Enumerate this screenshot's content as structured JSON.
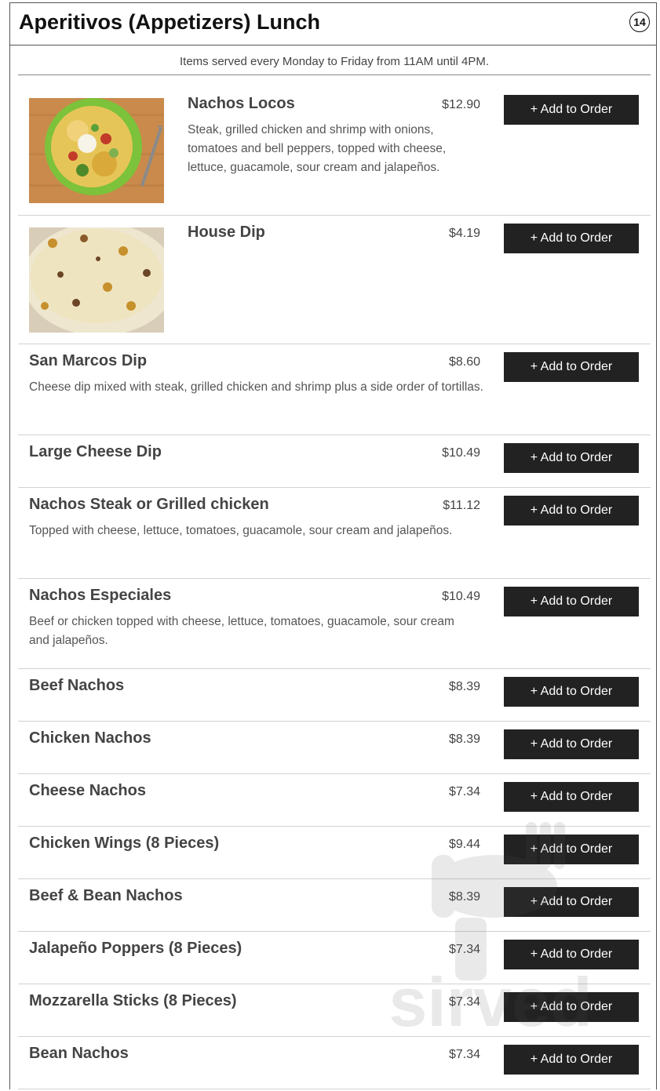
{
  "header": {
    "title": "Aperitivos (Appetizers) Lunch",
    "count": "14"
  },
  "subtitle": "Items served every Monday to Friday from 11AM until 4PM.",
  "watermark": "sirved",
  "items": [
    {
      "name": "Nachos Locos",
      "price": "$12.90",
      "desc": "Steak, grilled chicken and shrimp with onions, tomatoes and bell peppers, topped with cheese, lettuce, guacamole, sour cream and jalapeños.",
      "button": "+ Add to Order"
    },
    {
      "name": "House Dip",
      "price": "$4.19",
      "desc": "",
      "button": "+ Add to Order"
    },
    {
      "name": "San Marcos Dip",
      "price": "$8.60",
      "desc": "Cheese dip mixed with steak, grilled chicken and shrimp plus a side order of tortillas.",
      "button": "+ Add to Order"
    },
    {
      "name": "Large Cheese Dip",
      "price": "$10.49",
      "desc": "",
      "button": "+ Add to Order"
    },
    {
      "name": "Nachos Steak or Grilled chicken",
      "price": "$11.12",
      "desc": "Topped with cheese, lettuce, tomatoes, guacamole, sour cream and jalapeños.",
      "button": "+ Add to Order"
    },
    {
      "name": "Nachos Especiales",
      "price": "$10.49",
      "desc": "Beef or chicken topped with cheese, lettuce, tomatoes, guacamole, sour cream and jalapeños.",
      "button": "+ Add to Order"
    },
    {
      "name": "Beef Nachos",
      "price": "$8.39",
      "desc": "",
      "button": "+ Add to Order"
    },
    {
      "name": "Chicken Nachos",
      "price": "$8.39",
      "desc": "",
      "button": "+ Add to Order"
    },
    {
      "name": "Cheese Nachos",
      "price": "$7.34",
      "desc": "",
      "button": "+ Add to Order"
    },
    {
      "name": "Chicken Wings (8 Pieces)",
      "price": "$9.44",
      "desc": "",
      "button": "+ Add to Order"
    },
    {
      "name": "Beef & Bean Nachos",
      "price": "$8.39",
      "desc": "",
      "button": "+ Add to Order"
    },
    {
      "name": "Jalapeño Poppers (8 Pieces)",
      "price": "$7.34",
      "desc": "",
      "button": "+ Add to Order"
    },
    {
      "name": "Mozzarella Sticks (8 Pieces)",
      "price": "$7.34",
      "desc": "",
      "button": "+ Add to Order"
    },
    {
      "name": "Bean Nachos",
      "price": "$7.34",
      "desc": "",
      "button": "+ Add to Order"
    }
  ]
}
